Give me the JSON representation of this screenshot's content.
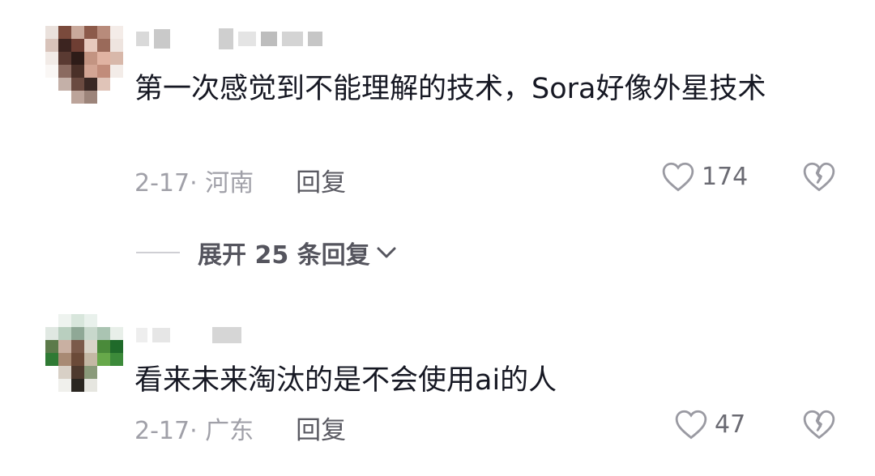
{
  "comments": [
    {
      "text": "第一次感觉到不能理解的技术，Sora好像外星技术",
      "date_location": "2-17· 河南",
      "reply_label": "回复",
      "likes": "174",
      "expand_label": "展开 25 条回复"
    },
    {
      "text": "看来未来淘汰的是不会使用ai的人",
      "date_location": "2-17· 广东",
      "reply_label": "回复",
      "likes": "47"
    }
  ],
  "icons": {
    "like": "heart-outline-icon",
    "dislike": "broken-heart-icon",
    "expand": "chevron-down-icon"
  },
  "colors": {
    "text": "#161823",
    "meta": "#a0a0a8",
    "reply": "#5a5a62"
  }
}
